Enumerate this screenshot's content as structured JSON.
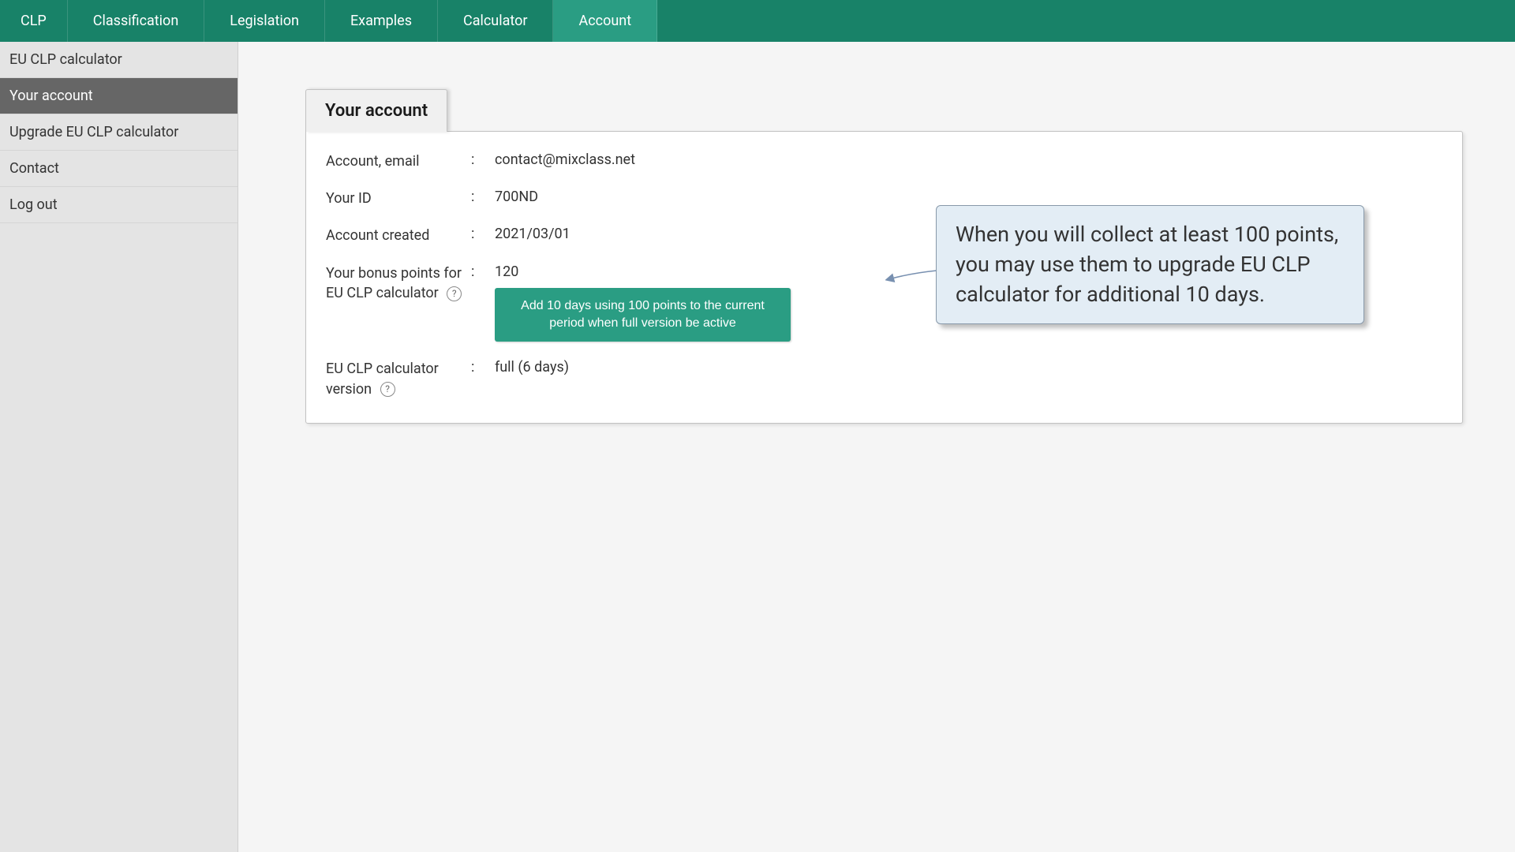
{
  "topnav": {
    "items": [
      {
        "label": "CLP"
      },
      {
        "label": "Classification"
      },
      {
        "label": "Legislation"
      },
      {
        "label": "Examples"
      },
      {
        "label": "Calculator"
      },
      {
        "label": "Account",
        "active": true
      }
    ]
  },
  "sidebar": {
    "items": [
      {
        "label": "EU CLP calculator"
      },
      {
        "label": "Your account",
        "active": true
      },
      {
        "label": "Upgrade EU CLP calculator"
      },
      {
        "label": "Contact"
      },
      {
        "label": "Log out"
      }
    ]
  },
  "panel": {
    "title": "Your account",
    "rows": {
      "email_label": "Account, email",
      "email_value": "contact@mixclass.net",
      "id_label": "Your ID",
      "id_value": "700ND",
      "created_label": "Account created",
      "created_value": "2021/03/01",
      "bonus_label": "Your bonus points for EU CLP calculator",
      "bonus_value": "120",
      "button_label": "Add 10 days using 100 points to the current period when full version be active",
      "version_label": "EU CLP calculator version",
      "version_value": "full (6 days)"
    },
    "help_icon_text": "?"
  },
  "callout": {
    "text": "When you will collect at least 100 points, you may use them to upgrade EU CLP calculator for additional 10 days."
  },
  "colon": ":"
}
